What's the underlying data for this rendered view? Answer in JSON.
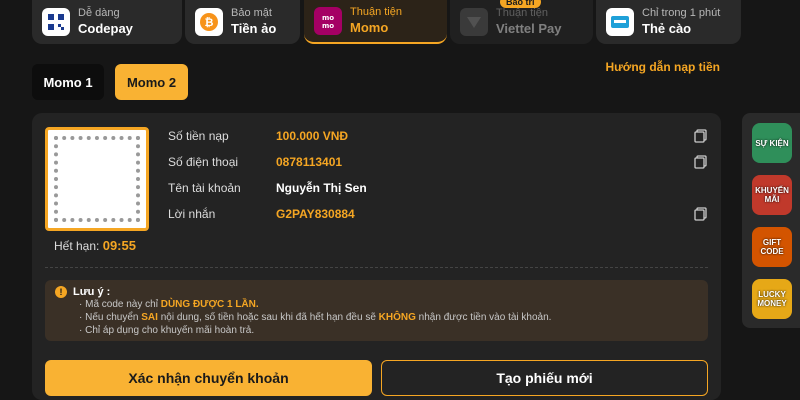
{
  "tabs": [
    {
      "sub": "Dễ dàng",
      "main": "Codepay",
      "icon": "qr-code-icon",
      "state": "normal"
    },
    {
      "sub": "Bảo mật",
      "main": "Tiền ảo",
      "icon": "bitcoin-icon",
      "state": "normal"
    },
    {
      "sub": "Thuận tiện",
      "main": "Momo",
      "icon": "momo-icon",
      "state": "active"
    },
    {
      "sub": "Thuận tiện",
      "main": "Viettel Pay",
      "icon": "viettel-icon",
      "state": "disabled",
      "badge": "Bảo trì"
    },
    {
      "sub": "Chỉ trong 1 phút",
      "main": "Thẻ cào",
      "icon": "scratch-card-icon",
      "state": "normal"
    }
  ],
  "subtabs": [
    {
      "label": "Momo 1",
      "active": false
    },
    {
      "label": "Momo 2",
      "active": true
    }
  ],
  "guide_link": "Hướng dẫn nạp tiền",
  "qr": {
    "expiry_label": "Hết hạn:",
    "expiry_time": "09:55"
  },
  "fields": [
    {
      "label": "Số tiền nạp",
      "value": "100.000 VNĐ",
      "copy": true,
      "value_color": "accent"
    },
    {
      "label": "Số điện thoại",
      "value": "0878113401",
      "copy": true,
      "value_color": "accent"
    },
    {
      "label": "Tên tài khoản",
      "value": "Nguyễn Thị Sen",
      "copy": false,
      "value_color": "white"
    },
    {
      "label": "Lời nhắn",
      "value": "G2PAY830884",
      "copy": true,
      "value_color": "accent"
    }
  ],
  "note": {
    "title": "Lưu ý :",
    "lines": [
      {
        "pre": "· Mã code này chỉ ",
        "bold": "DÙNG ĐƯỢC 1 LẦN.",
        "post": ""
      },
      {
        "pre": "· Nếu chuyển ",
        "bold": "SAI",
        "post": " nội dung, số tiền hoặc sau khi đã hết hạn đều sẽ ",
        "bold2": "KHÔNG",
        "post2": " nhận được tiền vào tài khoản."
      },
      {
        "pre": "· Chỉ áp dụng cho khuyến mãi hoàn trả.",
        "bold": "",
        "post": ""
      }
    ]
  },
  "buttons": {
    "confirm": "Xác nhận chuyển khoản",
    "new_ticket": "Tạo phiếu mới"
  },
  "promos": [
    {
      "label": "SỰ KIỆN",
      "icon": "event-icon",
      "color": "#2f8f5a"
    },
    {
      "label": "KHUYẾN MÃI",
      "icon": "promotion-icon",
      "color": "#c0392b"
    },
    {
      "label": "GIFT CODE",
      "icon": "gift-code-icon",
      "color": "#d35400"
    },
    {
      "label": "LUCKY MONEY",
      "icon": "lucky-money-icon",
      "color": "#e6a817"
    }
  ],
  "colors": {
    "accent": "#f5a623",
    "button": "#f9b233",
    "bg": "#161616",
    "card": "#232323"
  }
}
